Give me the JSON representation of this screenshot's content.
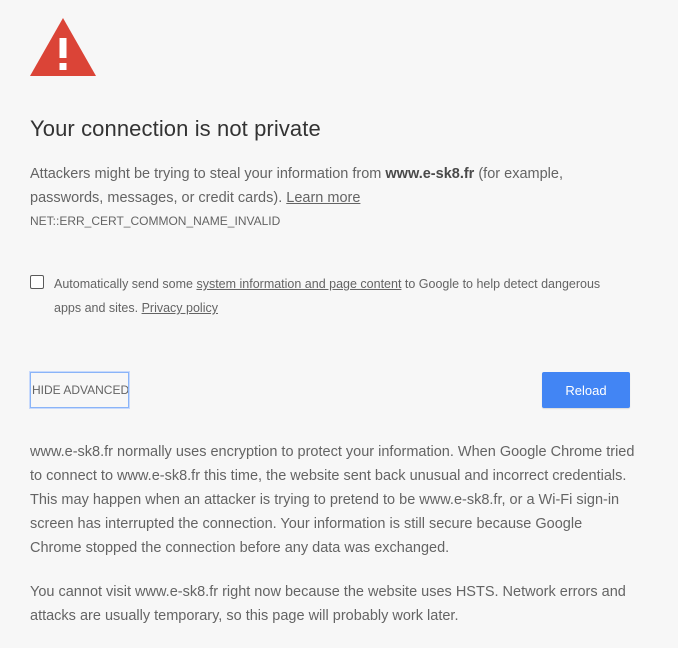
{
  "colors": {
    "background": "#f7f7f7",
    "warning_red": "#db4437",
    "primary_button": "#4285f4",
    "text": "#646464",
    "heading": "#333333"
  },
  "icon": {
    "name": "warning-triangle-icon"
  },
  "heading": "Your connection is not private",
  "explanation": {
    "prefix": "Attackers might be trying to steal your information from ",
    "host": "www.e-sk8.fr",
    "suffix": " (for example, passwords, messages, or credit cards). ",
    "learn_more": "Learn more"
  },
  "error_code": "NET::ERR_CERT_COMMON_NAME_INVALID",
  "extended_reporting": {
    "checked": false,
    "prefix": "Automatically send some ",
    "link": "system information and page content",
    "middle": " to Google to help detect dangerous apps and sites. ",
    "privacy_link": "Privacy policy"
  },
  "buttons": {
    "advanced": "HIDE ADVANCED",
    "reload": "Reload"
  },
  "details": {
    "paragraph1": "www.e-sk8.fr normally uses encryption to protect your information. When Google Chrome tried to connect to www.e-sk8.fr this time, the website sent back unusual and incorrect credentials. This may happen when an attacker is trying to pretend to be www.e-sk8.fr, or a Wi-Fi sign-in screen has interrupted the connection. Your information is still secure because Google Chrome stopped the connection before any data was exchanged.",
    "paragraph2": "You cannot visit www.e-sk8.fr right now because the website uses HSTS. Network errors and attacks are usually temporary, so this page will probably work later."
  }
}
